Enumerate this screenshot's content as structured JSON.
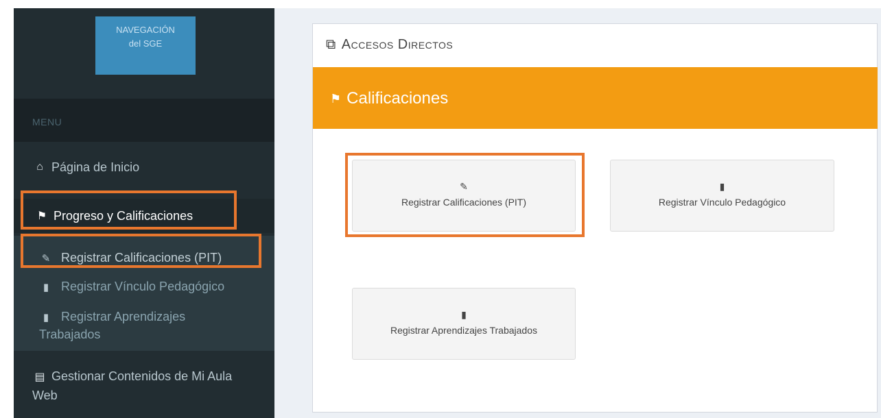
{
  "sidebar": {
    "nav_badge": {
      "line1": "NAVEGACIÓN",
      "line2": "del SGE"
    },
    "menu_header": "MENU",
    "home": {
      "icon": "home-icon",
      "label": "Página de Inicio"
    },
    "progreso": {
      "icon": "flag-checkered-icon",
      "label": "Progreso y Calificaciones"
    },
    "submenu": [
      {
        "icon": "edit-icon",
        "label": "Registrar Calificaciones (PIT)"
      },
      {
        "icon": "book-icon",
        "label": "Registrar Vínculo Pedagógico"
      },
      {
        "icon": "book-icon",
        "label": "Registrar Aprendizajes Trabajados"
      }
    ],
    "gestionar": {
      "icon": "newspaper-icon",
      "label": "Gestionar Contenidos de Mi Aula Web"
    }
  },
  "panel": {
    "title": "Accesos Directos",
    "title_icon": "external-link-icon",
    "section_title": "Calificaciones",
    "section_icon": "flag-checkered-icon",
    "cards": [
      {
        "icon": "edit-icon",
        "label": "Registrar Calificaciones (PIT)"
      },
      {
        "icon": "book-icon",
        "label": "Registrar Vínculo Pedagógico"
      },
      {
        "icon": "book-icon",
        "label": "Registrar Aprendizajes Trabajados"
      }
    ]
  },
  "colors": {
    "sidebar_bg": "#222d32",
    "accent_orange": "#f39c12",
    "highlight_border": "#e8772e",
    "nav_badge_blue": "#3c8dbc"
  }
}
